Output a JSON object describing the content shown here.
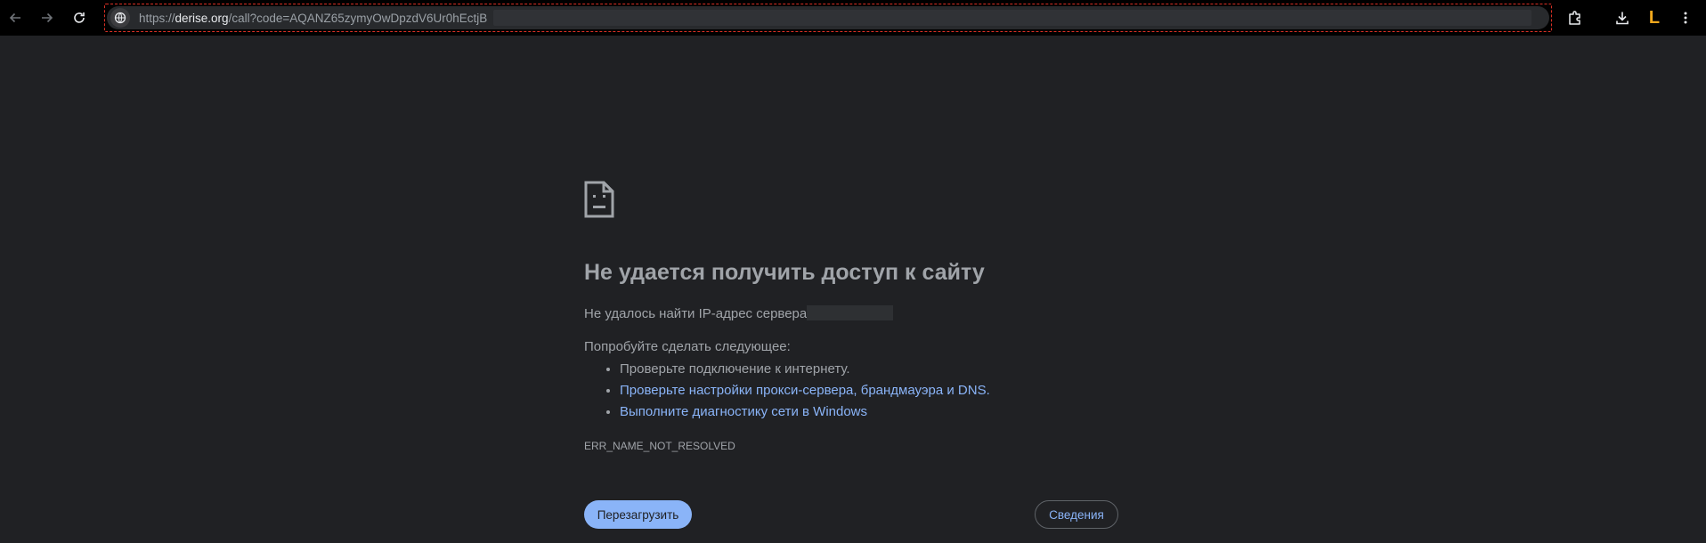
{
  "browser": {
    "url": {
      "scheme": "https://",
      "host": "derise.org",
      "path": "/call?code=AQANZ65zymyOwDpzdV6Ur0hEctjB"
    },
    "profile_initial": "L",
    "icons": {
      "back": "arrow-left-icon",
      "forward": "arrow-right-icon",
      "reload": "reload-icon",
      "site_info": "site-info-icon",
      "extensions": "extensions-icon",
      "downloads": "download-icon",
      "menu": "more-vert-icon"
    }
  },
  "error_page": {
    "icon": "sad-document-icon",
    "title": "Не удается получить доступ к сайту",
    "subtitle": "Не удалось найти IP-адрес сервера",
    "try_intro": "Попробуйте сделать следующее:",
    "suggestions": {
      "check_connection": "Проверьте подключение к интернету.",
      "check_proxy": "Проверьте настройки прокси-сервера, брандмауэра и DNS.",
      "run_diagnostics": "Выполните диагностику сети в Windows"
    },
    "error_code": "ERR_NAME_NOT_RESOLVED",
    "reload_label": "Перезагрузить",
    "details_label": "Сведения"
  },
  "colors": {
    "background": "#202124",
    "toolbar": "#000000",
    "text": "#9aa0a6",
    "link": "#8ab4f8",
    "profile_accent": "#f2a81d"
  }
}
